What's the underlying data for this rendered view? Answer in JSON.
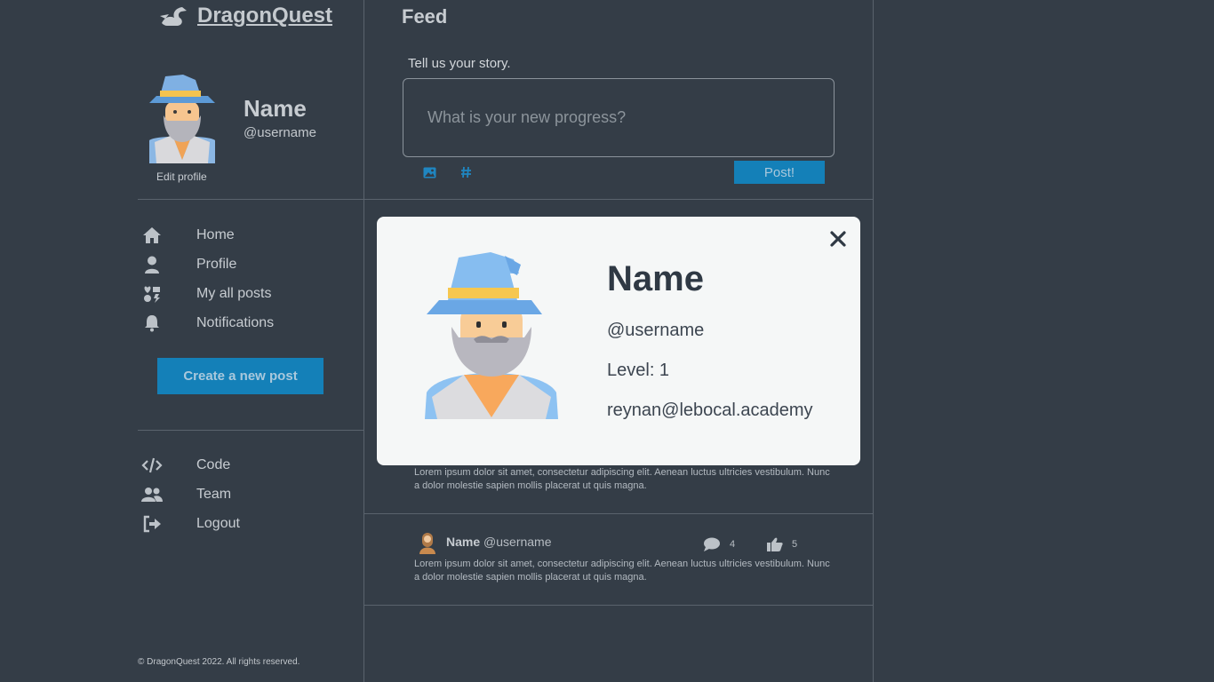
{
  "brand": {
    "name": "DragonQuest"
  },
  "profile": {
    "name": "Name",
    "username": "@username",
    "edit_label": "Edit profile"
  },
  "nav": {
    "main": [
      {
        "label": "Home",
        "icon": "home-icon"
      },
      {
        "label": "Profile",
        "icon": "user-icon"
      },
      {
        "label": "My all posts",
        "icon": "posts-icon"
      },
      {
        "label": "Notifications",
        "icon": "bell-icon"
      }
    ],
    "create_label": "Create a new post",
    "secondary": [
      {
        "label": "Code",
        "icon": "code-icon"
      },
      {
        "label": "Team",
        "icon": "team-icon"
      },
      {
        "label": "Logout",
        "icon": "logout-icon"
      }
    ]
  },
  "footer": {
    "copyright": "© DragonQuest 2022. All rights reserved."
  },
  "feed": {
    "title": "Feed",
    "story_label": "Tell us your story.",
    "story_placeholder": "What is your new progress?",
    "post_label": "Post!",
    "posts": [
      {
        "text": "Lorem ipsum dolor sit amet, consectetur adipiscing elit. Aenean luctus ultricies vestibulum. Nunc a dolor molestie sapien mollis placerat ut quis magna."
      },
      {
        "name": "Name",
        "username": "@username",
        "comments": "4",
        "likes": "5",
        "text": "Lorem ipsum dolor sit amet, consectetur adipiscing elit. Aenean luctus ultricies vestibulum. Nunc a dolor molestie sapien mollis placerat ut quis magna."
      }
    ]
  },
  "modal": {
    "name": "Name",
    "username": "@username",
    "level": "Level: 1",
    "email": "reynan@lebocal.academy"
  },
  "colors": {
    "accent": "#1480b8",
    "background": "#343d47",
    "modal_bg": "#f5f7f7"
  }
}
